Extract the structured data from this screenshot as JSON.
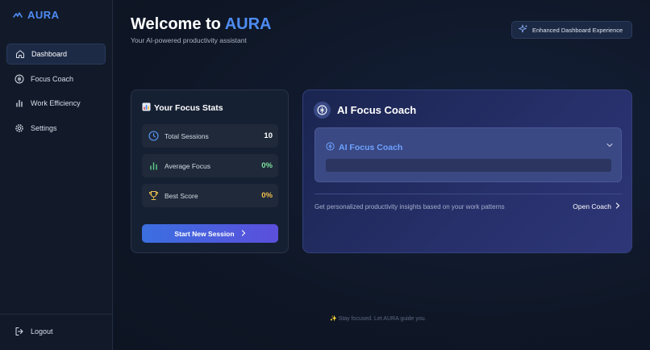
{
  "sidebar": {
    "brand": "AURA",
    "items": [
      {
        "label": "Dashboard",
        "icon": "home-icon",
        "active": true
      },
      {
        "label": "Focus Coach",
        "icon": "brain-icon"
      },
      {
        "label": "Work Efficiency",
        "icon": "bar-chart-icon"
      },
      {
        "label": "Settings",
        "icon": "gear-icon"
      }
    ],
    "logout_label": "Logout"
  },
  "header": {
    "welcome_prefix": "Welcome to",
    "welcome_brand": "AURA",
    "subtitle": "Your AI-powered productivity assistant",
    "badge_label": "Enhanced Dashboard Experience"
  },
  "stats": {
    "title": "Your Focus Stats",
    "rows": [
      {
        "label": "Total Sessions",
        "value": "10",
        "icon": "clock-icon"
      },
      {
        "label": "Average Focus",
        "value": "0%",
        "icon": "bar-chart-icon"
      },
      {
        "label": "Best Score",
        "value": "0%",
        "icon": "trophy-icon"
      }
    ],
    "start_button": "Start New Session"
  },
  "coach": {
    "title": "AI Focus Coach",
    "panel_title": "AI Focus Coach",
    "description": "Get personalized productivity insights based on your work patterns",
    "open_label": "Open Coach"
  },
  "footer": "✨ Stay focused. Let AURA guide you.",
  "colors": {
    "accent": "#4f8cf2",
    "background": "#0e1626",
    "green": "#7fe3a0",
    "button_start": "#3b6fe0",
    "button_end": "#5b4fdc"
  }
}
